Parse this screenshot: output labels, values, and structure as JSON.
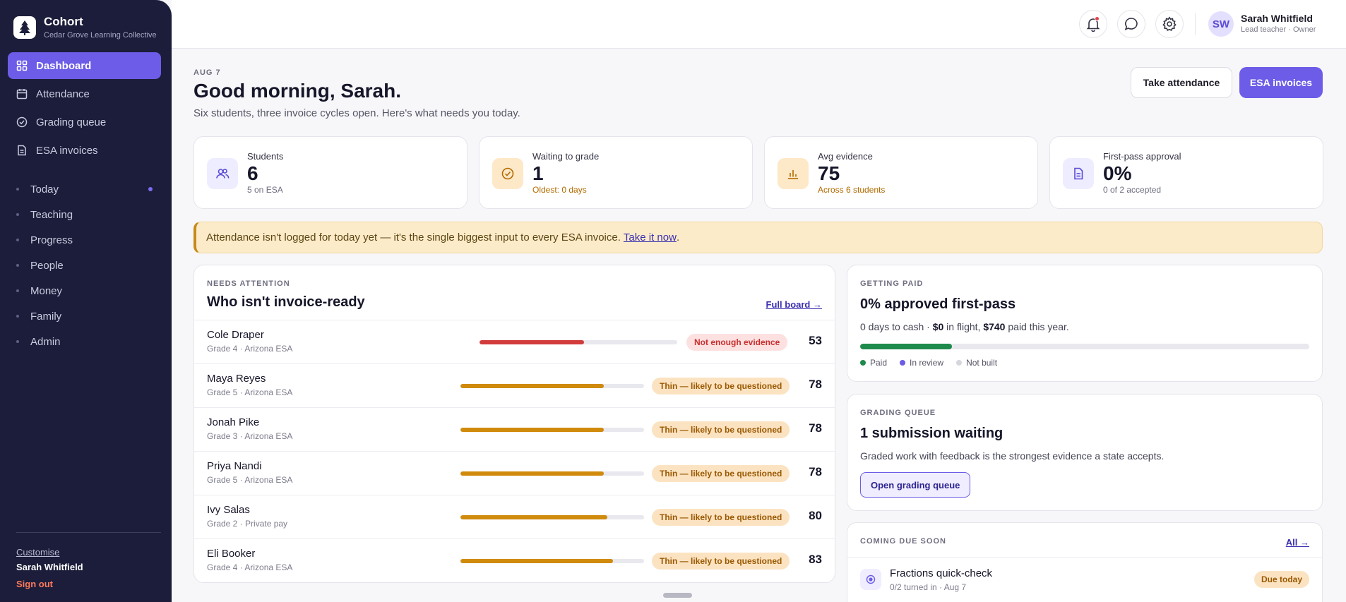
{
  "brand": {
    "name": "Cohort",
    "subtitle": "Cedar Grove Learning Collective"
  },
  "nav": {
    "main": [
      {
        "label": "Dashboard",
        "icon": "grid-icon",
        "active": true
      },
      {
        "label": "Attendance",
        "icon": "calendar-icon"
      },
      {
        "label": "Grading queue",
        "icon": "check-circle-icon"
      },
      {
        "label": "ESA invoices",
        "icon": "document-icon"
      }
    ],
    "secondary": [
      "Today",
      "Teaching",
      "Progress",
      "People",
      "Money",
      "Family",
      "Admin"
    ]
  },
  "footer": {
    "customise": "Customise",
    "user": "Sarah Whitfield",
    "signout": "Sign out"
  },
  "topbar": {
    "avatar_initials": "SW",
    "user_name": "Sarah Whitfield",
    "user_role": "Lead teacher · Owner"
  },
  "header": {
    "date": "AUG 7",
    "greeting": "Good morning, Sarah.",
    "subtitle": "Six students, three invoice cycles open. Here's what needs you today.",
    "btn_attendance": "Take attendance",
    "btn_invoices": "ESA invoices"
  },
  "stats": [
    {
      "label": "Students",
      "value": "6",
      "sub": "5 on ESA"
    },
    {
      "label": "Waiting to grade",
      "value": "1",
      "sub": "Oldest: 0 days"
    },
    {
      "label": "Avg evidence",
      "value": "75",
      "sub": "Across 6 students"
    },
    {
      "label": "First-pass approval",
      "value": "0%",
      "sub": "0 of 2 accepted"
    }
  ],
  "alert": {
    "text": "Attendance isn't logged for today yet — it's the single biggest input to every ESA invoice.",
    "link": "Take it now",
    "tail": "."
  },
  "needs": {
    "eyebrow": "NEEDS ATTENTION",
    "title": "Who isn't invoice-ready",
    "link": "Full board →",
    "rows": [
      {
        "name": "Cole Draper",
        "meta": "Grade 4 · Arizona ESA",
        "status": "Not enough evidence",
        "score": "53",
        "progress": 0.53,
        "tone": "red"
      },
      {
        "name": "Maya Reyes",
        "meta": "Grade 5 · Arizona ESA",
        "status": "Thin — likely to be questioned",
        "score": "78",
        "progress": 0.78,
        "tone": "amber"
      },
      {
        "name": "Jonah Pike",
        "meta": "Grade 3 · Arizona ESA",
        "status": "Thin — likely to be questioned",
        "score": "78",
        "progress": 0.78,
        "tone": "amber"
      },
      {
        "name": "Priya Nandi",
        "meta": "Grade 5 · Arizona ESA",
        "status": "Thin — likely to be questioned",
        "score": "78",
        "progress": 0.78,
        "tone": "amber"
      },
      {
        "name": "Ivy Salas",
        "meta": "Grade 2 · Private pay",
        "status": "Thin — likely to be questioned",
        "score": "80",
        "progress": 0.8,
        "tone": "amber"
      },
      {
        "name": "Eli Booker",
        "meta": "Grade 4 · Arizona ESA",
        "status": "Thin — likely to be questioned",
        "score": "83",
        "progress": 0.83,
        "tone": "amber"
      }
    ]
  },
  "paid": {
    "eyebrow": "GETTING PAID",
    "title": "0% approved first-pass",
    "desc_a": "0 days to cash · ",
    "desc_b": "$0",
    "desc_c": " in flight, ",
    "desc_d": "$740",
    "desc_e": " paid this year.",
    "paid_fraction": 0.205,
    "legend": [
      "Paid",
      "In review",
      "Not built"
    ],
    "colors": {
      "paid": "#1e8a4c",
      "review": "#6c5ce7",
      "notbuilt": "#d6d6de"
    }
  },
  "grading": {
    "eyebrow": "GRADING QUEUE",
    "title": "1 submission waiting",
    "desc": "Graded work with feedback is the strongest evidence a state accepts.",
    "button": "Open grading queue"
  },
  "due": {
    "eyebrow": "COMING DUE SOON",
    "link": "All →",
    "items": [
      {
        "name": "Fractions quick-check",
        "meta": "0/2 turned in · Aug 7",
        "badge": "Due today"
      }
    ]
  },
  "colors": {
    "accent": "#6c5ce7",
    "sidebar": "#1b1d3a",
    "red": "#d23b3b",
    "amber": "#d08a0c"
  }
}
